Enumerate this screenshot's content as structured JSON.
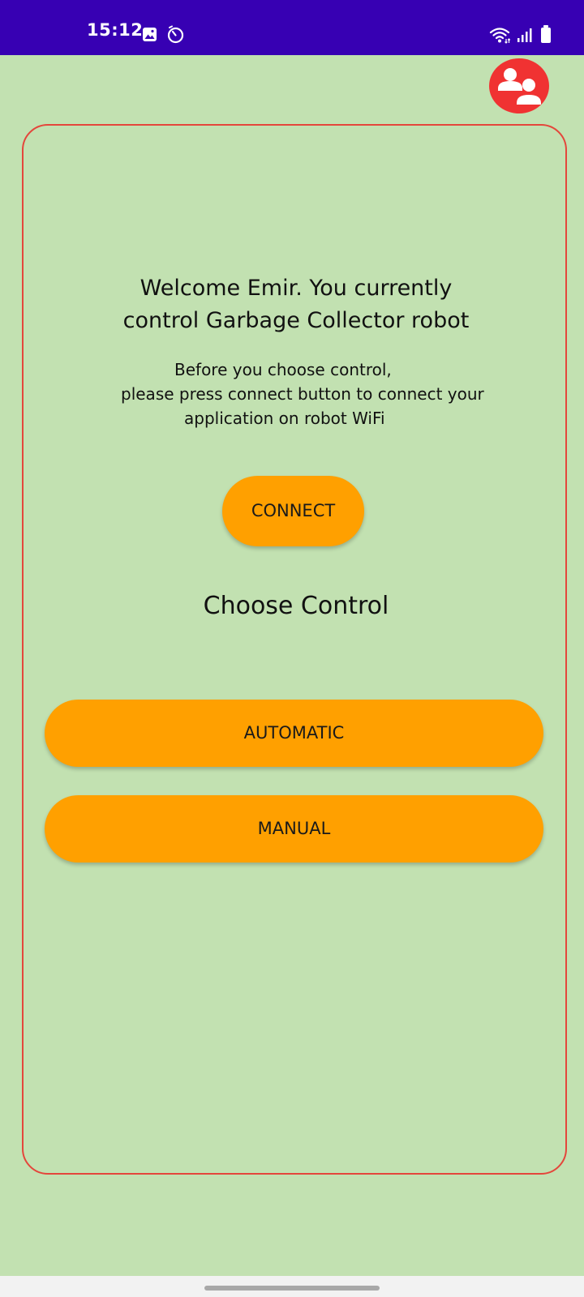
{
  "status_bar": {
    "time": "15:12",
    "left_icons": [
      "image-icon",
      "timer-icon"
    ],
    "right_icons": [
      "wifi-icon",
      "signal-icon",
      "battery-icon"
    ]
  },
  "header": {
    "profile_icon": "account-switch-icon"
  },
  "main": {
    "welcome_lines": [
      "Welcome Emir. You currently",
      "control Garbage Collector robot"
    ],
    "instruction_lines": [
      "Before you choose control,",
      "please press connect button to connect your",
      "application on robot WiFi"
    ],
    "connect_label": "CONNECT",
    "choose_title": "Choose Control",
    "automatic_label": "AUTOMATIC",
    "manual_label": "MANUAL"
  },
  "colors": {
    "background": "#c2e1b1",
    "status_bar": "#3700b3",
    "accent_button": "#ffa000",
    "card_border": "#e4463b",
    "profile_button": "#f03232"
  }
}
